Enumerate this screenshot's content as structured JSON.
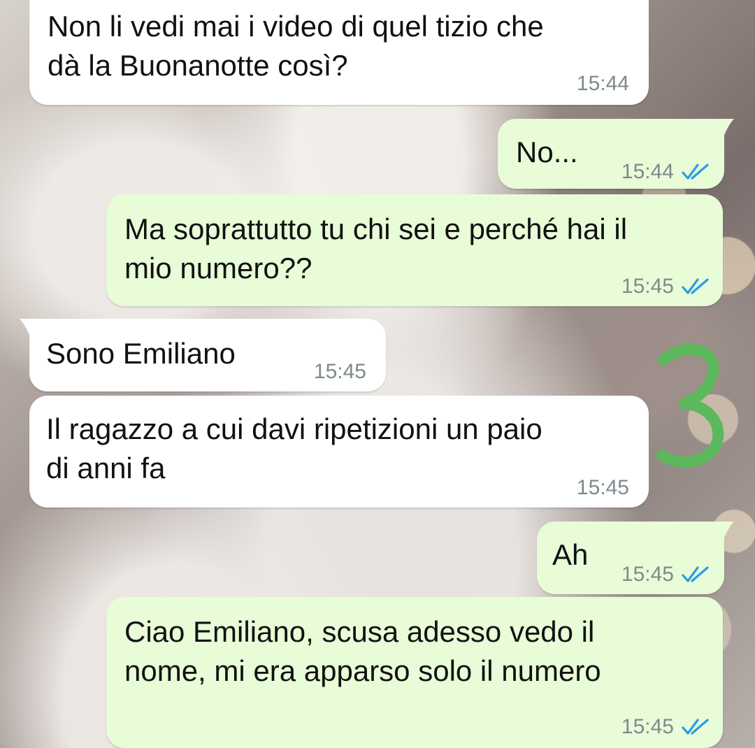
{
  "colors": {
    "incoming_bubble": "#ffffff",
    "outgoing_bubble": "#e7fcd7",
    "timestamp": "#7d8a8e",
    "read_ticks": "#2f9ae5",
    "annotation": "#5cb85c"
  },
  "messages": [
    {
      "direction": "incoming",
      "text": "Non li vedi mai i video di quel tizio che\ndà la Buonanotte così?",
      "time": "15:44"
    },
    {
      "direction": "outgoing",
      "text": "No...",
      "time": "15:44",
      "status_icon": "double-check-read-icon"
    },
    {
      "direction": "outgoing",
      "text": "Ma soprattutto tu chi sei e perché hai il\nmio numero??",
      "time": "15:45",
      "status_icon": "double-check-read-icon"
    },
    {
      "direction": "incoming",
      "text": "Sono Emiliano",
      "time": "15:45"
    },
    {
      "direction": "incoming",
      "text": "Il ragazzo a cui davi ripetizioni un paio\ndi anni fa",
      "time": "15:45"
    },
    {
      "direction": "outgoing",
      "text": "Ah",
      "time": "15:45",
      "status_icon": "double-check-read-icon"
    },
    {
      "direction": "outgoing",
      "text": "Ciao Emiliano, scusa adesso vedo il\nnome, mi era apparso solo il numero",
      "time": "15:45",
      "status_icon": "double-check-read-icon"
    }
  ],
  "annotation": {
    "text": "3"
  }
}
